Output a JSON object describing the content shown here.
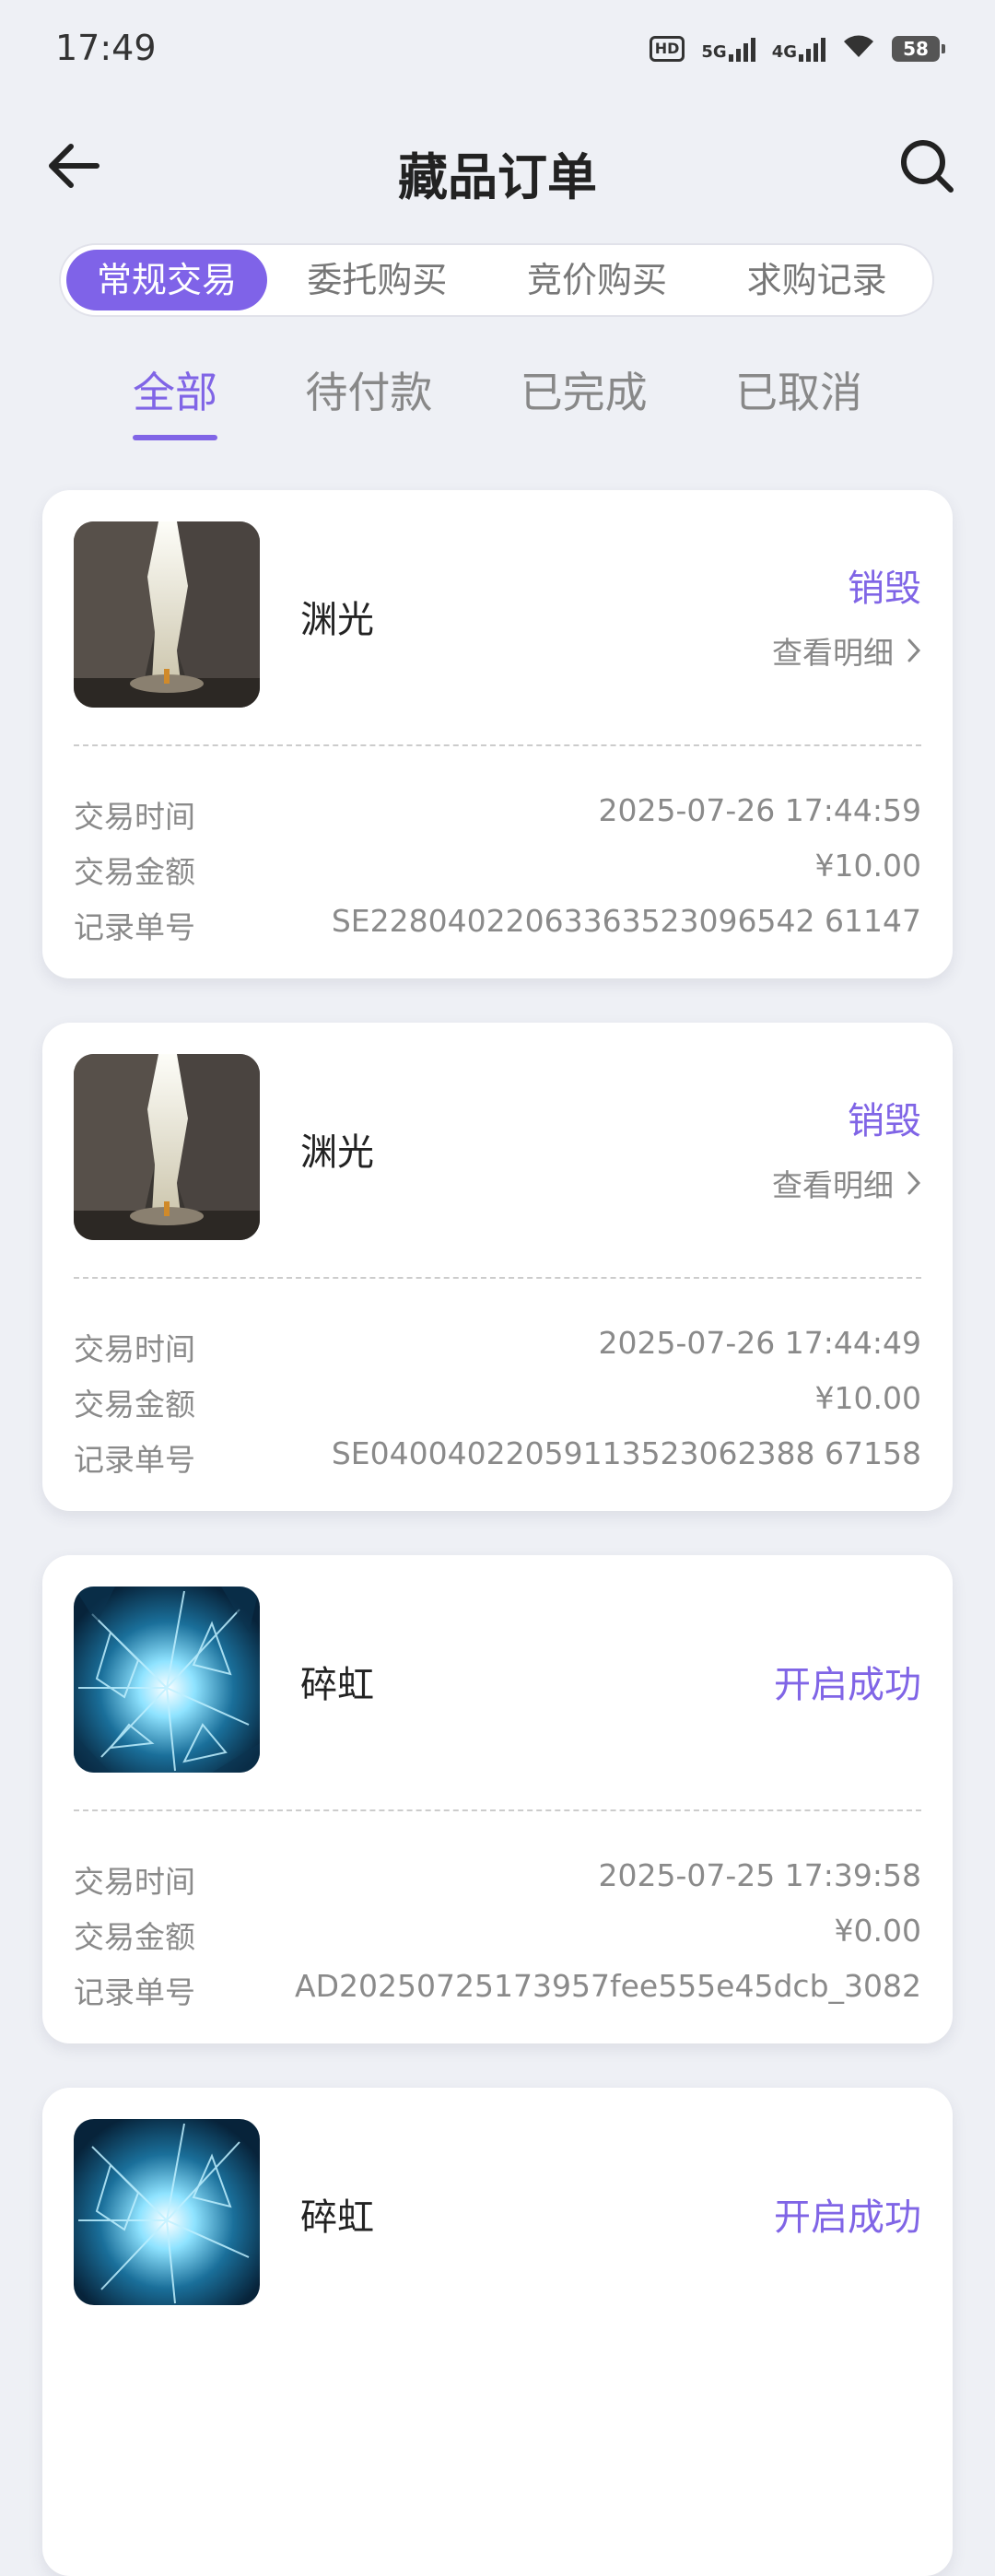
{
  "status_bar": {
    "time": "17:49",
    "hd_label": "HD",
    "net1": "5G",
    "net2": "4G",
    "battery": "58",
    "icons": [
      "hd-icon",
      "signal-5g-icon",
      "signal-4g-icon",
      "wifi-icon",
      "battery-icon"
    ]
  },
  "header": {
    "title": "藏品订单",
    "back_icon": "back-arrow-icon",
    "search_icon": "search-icon"
  },
  "type_tabs": [
    {
      "label": "常规交易",
      "active": true
    },
    {
      "label": "委托购买",
      "active": false
    },
    {
      "label": "竞价购买",
      "active": false
    },
    {
      "label": "求购记录",
      "active": false
    }
  ],
  "status_tabs": [
    {
      "label": "全部",
      "active": true
    },
    {
      "label": "待付款",
      "active": false
    },
    {
      "label": "已完成",
      "active": false
    },
    {
      "label": "已取消",
      "active": false
    }
  ],
  "accent_color": "#8065e6",
  "orders": [
    {
      "name": "渊光",
      "status": "销毁",
      "detail_link": "查看明细",
      "image": "canyon-light",
      "time_label": "交易时间",
      "time": "2025-07-26 17:44:59",
      "amount_label": "交易金额",
      "amount": "¥10.00",
      "id_label": "记录单号",
      "id": "SE22804022063363523096542 61147"
    },
    {
      "name": "渊光",
      "status": "销毁",
      "detail_link": "查看明细",
      "image": "canyon-light",
      "time_label": "交易时间",
      "time": "2025-07-26 17:44:49",
      "amount_label": "交易金额",
      "amount": "¥10.00",
      "id_label": "记录单号",
      "id": "SE04004022059113523062388 67158"
    },
    {
      "name": "碎虹",
      "status": "开启成功",
      "image": "crystal-shards",
      "time_label": "交易时间",
      "time": "2025-07-25 17:39:58",
      "amount_label": "交易金额",
      "amount": "¥0.00",
      "id_label": "记录单号",
      "id": "AD20250725173957fee555e45dcb_3082"
    },
    {
      "name": "碎虹",
      "status": "开启成功",
      "image": "crystal-shards"
    }
  ]
}
